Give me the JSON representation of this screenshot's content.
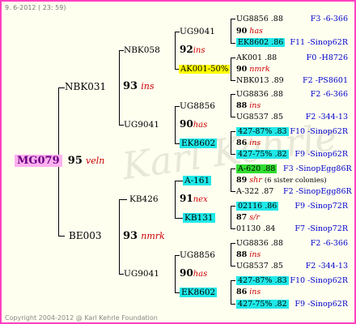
{
  "header": {
    "date": "9.  6-2012 ( 23: 59)"
  },
  "footer": {
    "copyright": "Copyright 2004-2012 @ Karl Kehrle Foundation"
  },
  "root": {
    "id": "MG079",
    "num": "95",
    "tag": "veln"
  },
  "gen1": [
    {
      "id": "NBK031",
      "num": "93",
      "tag": "ins"
    },
    {
      "id": "BE003",
      "num": "93",
      "tag": "nmrk"
    }
  ],
  "gen2": [
    {
      "id": "NBK058",
      "num": "92",
      "tag": "ins"
    },
    {
      "id": "UG9041",
      "num": "90",
      "tag": "has"
    },
    {
      "id": "KB426",
      "num": "91",
      "tag": "nex"
    },
    {
      "id": "UG9041",
      "num": "90",
      "tag": "has"
    }
  ],
  "gen3": [
    {
      "id": "UG9041"
    },
    {
      "id": "AK001-50%"
    },
    {
      "id": "UG8856"
    },
    {
      "id": "EK8602"
    },
    {
      "id": "A-161"
    },
    {
      "id": "KB131"
    },
    {
      "id": "UG8856"
    },
    {
      "id": "EK8602"
    }
  ],
  "gen4": [
    {
      "id": "UG8856 .88",
      "ref": "F3 -6-366"
    },
    {
      "num": "90",
      "tag": "has"
    },
    {
      "id": "EK8602 .86",
      "ref": "F11 -Sinop62R"
    },
    {
      "id": "AK001 .88",
      "ref": "F0 -H8726"
    },
    {
      "num": "90",
      "tag": "nmrk"
    },
    {
      "id": "NBK013 .89",
      "ref": "F2 -PS8601"
    },
    {
      "id": "UG8836 .88",
      "ref": "F2 -6-366"
    },
    {
      "num": "88",
      "tag": "ins"
    },
    {
      "id": "UG8537 .85",
      "ref": "F2 -344-13"
    },
    {
      "id": "427-87% .83",
      "ref": "F10 -Sinop62R"
    },
    {
      "num": "86",
      "tag": "ins"
    },
    {
      "id": "427-75% .82",
      "ref": "F9 -Sinop62R"
    },
    {
      "id": "A-620 .88",
      "ref": "F3 -SinopEgg86R"
    },
    {
      "num": "89",
      "tag": "shr",
      "note": "(6 sister colonies)"
    },
    {
      "id": "A-322 .87",
      "ref": "F2 -SinopEgg86R"
    },
    {
      "id": "02116 .86",
      "ref": "F9 -Sinop72R"
    },
    {
      "num": "87",
      "tag": "s/r"
    },
    {
      "id": "01130 .84",
      "ref": "F7 -Sinop72R"
    },
    {
      "id": "UG8836 .88",
      "ref": "F2 -6-366"
    },
    {
      "num": "88",
      "tag": "ins"
    },
    {
      "id": "UG8537 .85",
      "ref": "F2 -344-13"
    },
    {
      "id": "427-87% .83",
      "ref": "F10 -Sinop62R"
    },
    {
      "num": "86",
      "tag": "ins"
    },
    {
      "id": "427-75% .82",
      "ref": "F9 -Sinop62R"
    }
  ]
}
